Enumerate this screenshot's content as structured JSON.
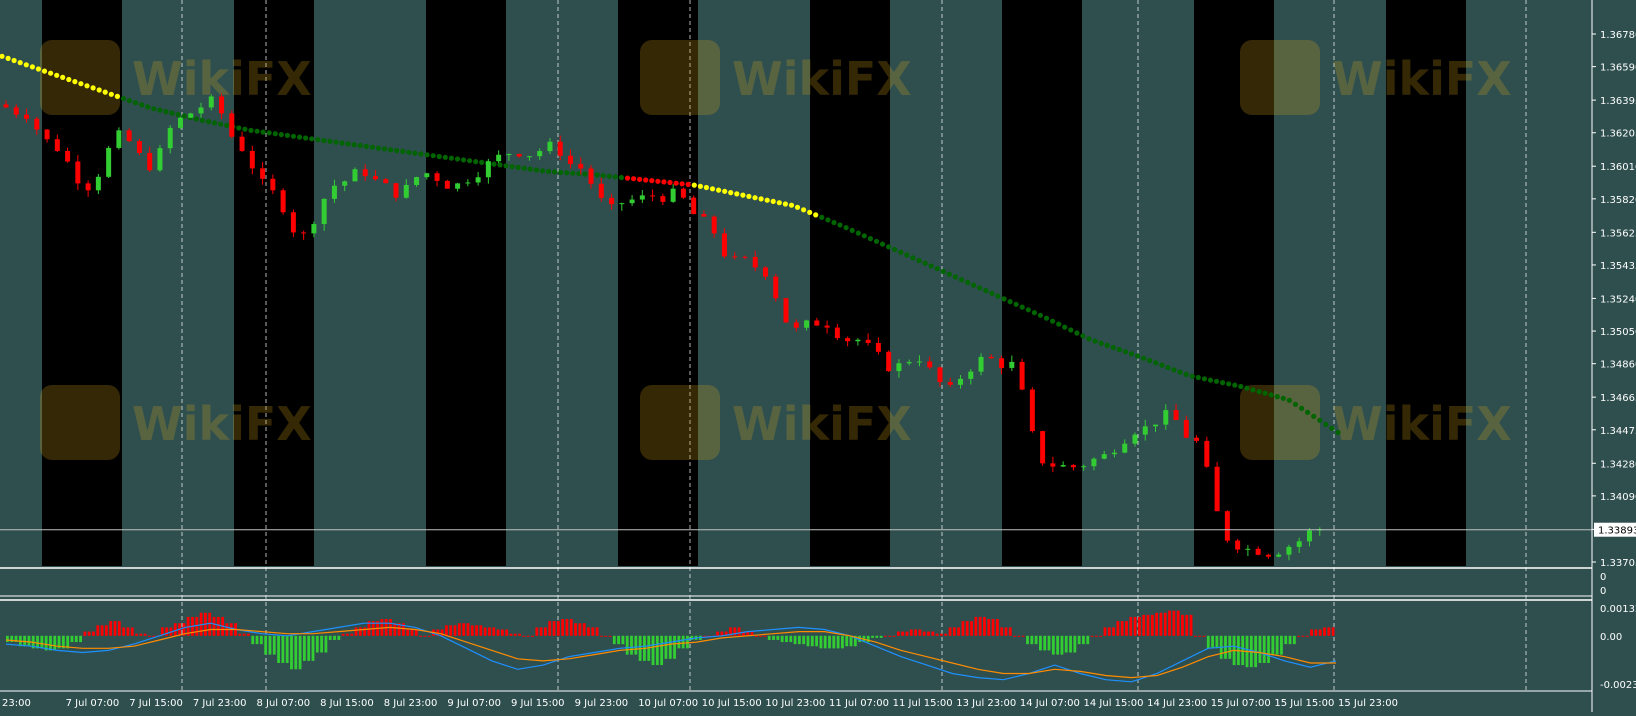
{
  "colors": {
    "background": "#2f4f4f",
    "session_band": "#000000",
    "bull_candle": "#32cd32",
    "bear_candle": "#ff0000",
    "ma_trend": "#006400",
    "ma_alt": "#ffff00",
    "ma_alt2": "#ff0000",
    "osc_pos": "#ff0000",
    "osc_neg": "#32cd32",
    "signal_a": "#1e90ff",
    "signal_b": "#ff8c00",
    "axis_text": "#ffffff",
    "grid": "#ffffff",
    "watermark": "#d4a017"
  },
  "watermark_text": "WikiFX",
  "chart_data": [
    {
      "type": "candlestick",
      "instrument_hint": "GBPUSD-like pair, H1",
      "price_axis_ticks": [
        "1.36780",
        "1.36590",
        "1.36395",
        "1.36205",
        "1.36010",
        "1.35820",
        "1.35625",
        "1.35435",
        "1.35240",
        "1.35050",
        "1.34860",
        "1.34665",
        "1.34475",
        "1.34280",
        "1.34090",
        "1.33895",
        "1.33705"
      ],
      "ylim": [
        1.33705,
        1.3678
      ],
      "current_price_label": "1.33893",
      "current_price": 1.33893,
      "time_axis_labels": [
        "23:00",
        "7 Jul 07:00",
        "7 Jul 15:00",
        "7 Jul 23:00",
        "8 Jul 07:00",
        "8 Jul 15:00",
        "8 Jul 23:00",
        "9 Jul 07:00",
        "9 Jul 15:00",
        "9 Jul 23:00",
        "10 Jul 07:00",
        "10 Jul 15:00",
        "10 Jul 23:00",
        "11 Jul 07:00",
        "11 Jul 15:00",
        "13 Jul 23:00",
        "14 Jul 07:00",
        "14 Jul 15:00",
        "14 Jul 23:00",
        "15 Jul 07:00",
        "15 Jul 15:00",
        "15 Jul 23:00"
      ],
      "moving_average": [
        1.3665,
        1.3655,
        1.3645,
        1.3635,
        1.3628,
        1.3622,
        1.3618,
        1.3614,
        1.361,
        1.3606,
        1.3602,
        1.3598,
        1.3596,
        1.3593,
        1.359,
        1.3584,
        1.3578,
        1.3566,
        1.3553,
        1.354,
        1.3527,
        1.3514,
        1.35,
        1.349,
        1.3479,
        1.3473,
        1.3465,
        1.3446
      ],
      "close_series": [
        1.3632,
        1.3612,
        1.359,
        1.3618,
        1.3602,
        1.3628,
        1.3638,
        1.3612,
        1.3585,
        1.356,
        1.359,
        1.3598,
        1.3586,
        1.3597,
        1.359,
        1.3602,
        1.361,
        1.3612,
        1.36,
        1.3575,
        1.3582,
        1.3584,
        1.3568,
        1.3545,
        1.354,
        1.3505,
        1.351,
        1.35,
        1.3485,
        1.349,
        1.347,
        1.3488,
        1.3485,
        1.343,
        1.3426,
        1.3432,
        1.3448,
        1.3455,
        1.344,
        1.3385,
        1.3378,
        1.338,
        1.339
      ]
    },
    {
      "type": "oscillator_histogram",
      "subwindow_ticks": [
        "0",
        "0"
      ],
      "axis_ticks": [
        "0.001327",
        "0.00",
        "-0.002304"
      ],
      "ylim": [
        -0.002304,
        0.001327
      ],
      "histogram": [
        -0.0003,
        -0.0005,
        -0.0006,
        -0.0007,
        -0.0006,
        -0.0003,
        0.0002,
        0.0005,
        0.0007,
        0.0004,
        0.0001,
        0.0,
        0.0004,
        0.0006,
        0.0009,
        0.0011,
        0.0009,
        0.0006,
        0.0001,
        -0.0004,
        -0.0009,
        -0.0013,
        -0.0016,
        -0.0012,
        -0.0008,
        -0.0002,
        0.0001,
        0.0004,
        0.0007,
        0.0008,
        0.0006,
        0.0003,
        0.0,
        0.0003,
        0.0005,
        0.0006,
        0.0005,
        0.0004,
        0.0003,
        0.0001,
        0.0,
        0.0004,
        0.0007,
        0.0008,
        0.0006,
        0.0004,
        0.0,
        -0.0004,
        -0.0009,
        -0.0012,
        -0.0014,
        -0.0011,
        -0.0006,
        -0.0002,
        0.0,
        0.0002,
        0.0004,
        0.0002,
        0.0,
        -0.0002,
        -0.0003,
        -0.0004,
        -0.0005,
        -0.0006,
        -0.0006,
        -0.0005,
        -0.0003,
        -0.0001,
        0.0,
        0.0002,
        0.0003,
        0.0002,
        0.0001,
        0.0004,
        0.0007,
        0.0009,
        0.0008,
        0.0004,
        0.0,
        -0.0004,
        -0.0007,
        -0.0009,
        -0.0008,
        -0.0004,
        0.0,
        0.0004,
        0.0007,
        0.0009,
        0.001,
        0.0011,
        0.0012,
        0.001,
        0.0,
        -0.0006,
        -0.0011,
        -0.0014,
        -0.0015,
        -0.0013,
        -0.0009,
        -0.0004,
        0.0,
        0.0003,
        0.0004
      ],
      "signal_blue": [
        -0.0004,
        -0.0005,
        -0.0007,
        -0.0008,
        -0.0007,
        -0.0004,
        0.0,
        0.0004,
        0.0006,
        0.0003,
        0.0001,
        0.0,
        0.0002,
        0.0004,
        0.0006,
        0.0006,
        0.0004,
        0.0,
        -0.0006,
        -0.0012,
        -0.0016,
        -0.0014,
        -0.001,
        -0.0008,
        -0.0006,
        -0.0005,
        -0.0003,
        -0.0001,
        0.0,
        0.0002,
        0.0003,
        0.0004,
        0.0003,
        0.0,
        -0.0005,
        -0.001,
        -0.0014,
        -0.0018,
        -0.002,
        -0.0021,
        -0.0018,
        -0.0014,
        -0.0018,
        -0.0021,
        -0.0022,
        -0.0018,
        -0.0012,
        -0.0006,
        -0.0005,
        -0.0008,
        -0.0012,
        -0.0015,
        -0.0012
      ],
      "signal_orange": [
        -0.0002,
        -0.0003,
        -0.0005,
        -0.0006,
        -0.0006,
        -0.0005,
        -0.0002,
        0.0001,
        0.0003,
        0.0003,
        0.0002,
        0.0001,
        0.0001,
        0.0002,
        0.0003,
        0.0004,
        0.0003,
        0.0001,
        -0.0003,
        -0.0007,
        -0.0011,
        -0.0012,
        -0.0011,
        -0.0009,
        -0.0007,
        -0.0006,
        -0.0004,
        -0.0003,
        -0.0001,
        0.0,
        0.0001,
        0.0002,
        0.0002,
        0.0,
        -0.0003,
        -0.0007,
        -0.001,
        -0.0013,
        -0.0016,
        -0.0018,
        -0.0018,
        -0.0016,
        -0.0017,
        -0.0019,
        -0.002,
        -0.0019,
        -0.0015,
        -0.001,
        -0.0007,
        -0.0008,
        -0.001,
        -0.0013,
        -0.0013
      ]
    }
  ]
}
